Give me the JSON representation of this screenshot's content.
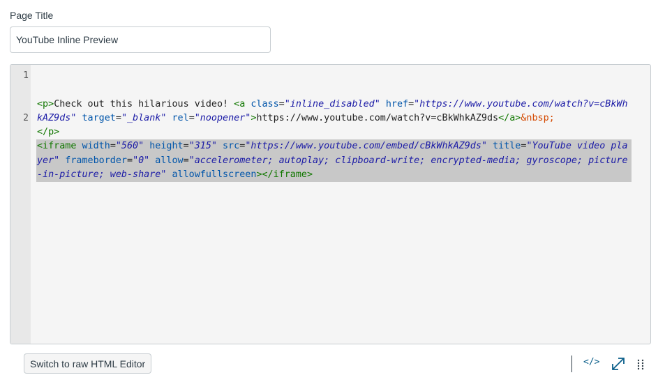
{
  "form": {
    "page_title_label": "Page Title",
    "page_title_value": "YouTube Inline Preview"
  },
  "editor": {
    "line_numbers": [
      "1",
      "2"
    ],
    "line1": {
      "p_open": "<p>",
      "text1": "Check out this hilarious video! ",
      "a_open_start": "<a",
      "attr_class": " class",
      "eq1": "=",
      "val_class": "\"inline_disabled\"",
      "attr_href": " href",
      "eq2": "=",
      "val_href": "\"https://www.youtube.com/watch?v=cBkWhkAZ9ds\"",
      "attr_target": " target",
      "eq3": "=",
      "val_target": "\"_blank\"",
      "attr_rel": " rel",
      "eq4": "=",
      "val_rel": "\"noopener\"",
      "a_open_end": ">",
      "link_text": "https://www.youtube.com/watch?v=cBkWhkAZ9ds",
      "a_close": "</a>",
      "nbsp": "&nbsp;",
      "p_close": "</p>"
    },
    "line2": {
      "iframe_open": "<iframe",
      "attr_width": " width",
      "eq1": "=",
      "val_width": "\"560\"",
      "attr_height": " height",
      "eq2": "=",
      "val_height": "\"315\"",
      "attr_src": " src",
      "eq3": "=",
      "val_src": "\"https://www.youtube.com/embed/cBkWhkAZ9ds\"",
      "attr_title": " title",
      "eq4": "=",
      "val_title": "\"YouTube video player\"",
      "attr_frameborder": " frameborder",
      "eq5": "=",
      "val_frameborder": "\"0\"",
      "attr_allow": " allow",
      "eq6": "=",
      "val_allow": "\"accelerometer; autoplay; clipboard-write; encrypted-media; gyroscope; picture-in-picture; web-share\"",
      "attr_allowfullscreen": " allowfullscreen",
      "iframe_open_end": ">",
      "iframe_close": "</iframe>"
    }
  },
  "footer": {
    "raw_html_button_label": "Switch to raw HTML Editor",
    "html_toggle_icon_text": "</>"
  },
  "colors": {
    "tag": "#117700",
    "attribute": "#0055aa",
    "string": "#1a1aa6",
    "entity": "#d44900",
    "selection": "#c8c8c8",
    "icon_accent": "#0b5f8a"
  },
  "icons": {
    "fullscreen": "expand-diagonal-icon",
    "resize": "drag-handle-dots-icon",
    "html_toggle": "code-brackets-icon"
  }
}
